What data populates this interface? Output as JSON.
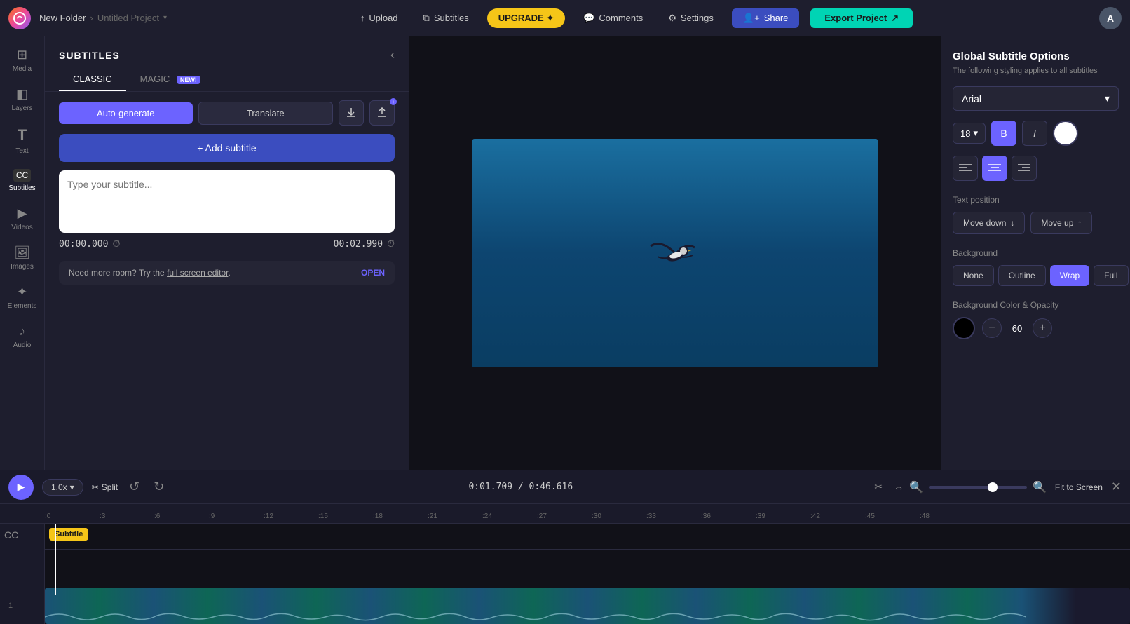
{
  "app": {
    "logo": "C",
    "folder": "New Folder",
    "project": "Untitled Project",
    "avatar": "A"
  },
  "nav": {
    "upload": "Upload",
    "subtitles": "Subtitles",
    "upgrade": "UPGRADE ✦",
    "comments": "Comments",
    "settings": "Settings",
    "share": "Share",
    "export": "Export Project"
  },
  "sidebar": {
    "items": [
      {
        "id": "media",
        "label": "Media",
        "icon": "⊞"
      },
      {
        "id": "layers",
        "label": "Layers",
        "icon": "◧"
      },
      {
        "id": "text",
        "label": "Text",
        "icon": "T"
      },
      {
        "id": "subtitles",
        "label": "Subtitles",
        "icon": "CC"
      },
      {
        "id": "videos",
        "label": "Videos",
        "icon": "▶"
      },
      {
        "id": "images",
        "label": "Images",
        "icon": "🖼"
      },
      {
        "id": "elements",
        "label": "Elements",
        "icon": "✦"
      },
      {
        "id": "audio",
        "label": "Audio",
        "icon": "♪"
      }
    ]
  },
  "subtitles_panel": {
    "title": "SUBTITLES",
    "tabs": [
      {
        "id": "classic",
        "label": "CLASSIC",
        "active": true
      },
      {
        "id": "magic",
        "label": "MAGIC",
        "active": false,
        "badge": "NEW!"
      }
    ],
    "btn_autogenerate": "Auto-generate",
    "btn_translate": "Translate",
    "btn_add_subtitle": "+ Add subtitle",
    "subtitle_placeholder": "Type your subtitle...",
    "timecode_start": "00:00.000",
    "timecode_end": "00:02.990",
    "more_room_text": "Need more room? Try the full screen editor.",
    "full_screen_editor_link": "full screen editor",
    "open_link": "OPEN"
  },
  "right_panel": {
    "title": "Global Subtitle Options",
    "subtitle": "The following styling applies to all subtitles",
    "font": "Arial",
    "font_size": "18",
    "format_bold": "B",
    "format_italic": "I",
    "align_left": "≡",
    "align_center": "≡",
    "align_right": "≡",
    "text_position_label": "Text position",
    "move_down": "Move down",
    "move_up": "Move up",
    "background_label": "Background",
    "bg_options": [
      "None",
      "Outline",
      "Wrap",
      "Full"
    ],
    "bg_active": "Wrap",
    "bg_color_label": "Background Color & Opacity",
    "opacity_value": "60"
  },
  "timeline": {
    "speed": "1.0x",
    "split": "Split",
    "timecode_current": "0:01.709",
    "timecode_total": "0:46.616",
    "fit_screen": "Fit to Screen",
    "ruler_marks": [
      ":0",
      ":3",
      ":6",
      ":9",
      ":12",
      ":15",
      ":18",
      ":21",
      ":24",
      ":27",
      ":30",
      ":33",
      ":36",
      ":39",
      ":42",
      ":45",
      ":48"
    ],
    "subtitle_chip": "Subtitle",
    "track_number": "1"
  }
}
